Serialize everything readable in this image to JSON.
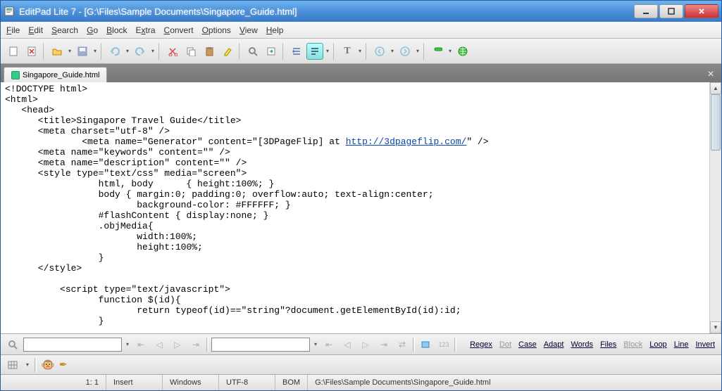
{
  "window": {
    "title": "EditPad Lite 7 - [G:\\Files\\Sample Documents\\Singapore_Guide.html]"
  },
  "menus": {
    "file": "File",
    "edit": "Edit",
    "search": "Search",
    "go": "Go",
    "block": "Block",
    "extra": "Extra",
    "convert": "Convert",
    "options": "Options",
    "view": "View",
    "help": "Help"
  },
  "tab": {
    "label": "Singapore_Guide.html"
  },
  "editor": {
    "l1": "<!DOCTYPE html>",
    "l2": "<html>",
    "l3": "   <head>",
    "l4": "      <title>Singapore Travel Guide</title>",
    "l5": "      <meta charset=\"utf-8\" />",
    "l6a": "              <meta name=\"Generator\" content=\"[3DPageFlip] at ",
    "l6link": "http://3dpageflip.com/",
    "l6b": "\" />",
    "l7": "      <meta name=\"keywords\" content=\"\" />",
    "l8": "      <meta name=\"description\" content=\"\" />",
    "l9": "      <style type=\"text/css\" media=\"screen\">",
    "l10": "                 html, body      { height:100%; }",
    "l11": "                 body { margin:0; padding:0; overflow:auto; text-align:center;",
    "l12": "                        background-color: #FFFFFF; }",
    "l13": "                 #flashContent { display:none; }",
    "l14": "                 .objMedia{",
    "l15": "                        width:100%;",
    "l16": "                        height:100%;",
    "l17": "                 }",
    "l18": "      </style>",
    "l19": "",
    "l20": "          <script type=\"text/javascript\">",
    "l21": "                 function $(id){",
    "l22": "                        return typeof(id)==\"string\"?document.getElementById(id):id;",
    "l23": "                 }"
  },
  "search_opts": {
    "regex": "Regex",
    "dot": "Dot",
    "case": "Case",
    "adapt": "Adapt",
    "words": "Words",
    "files": "Files",
    "block": "Block",
    "loop": "Loop",
    "line": "Line",
    "invert": "Invert"
  },
  "status": {
    "pos": "1: 1",
    "insert": "Insert",
    "eol": "Windows",
    "enc": "UTF-8",
    "bom": "BOM",
    "path": "G:\\Files\\Sample Documents\\Singapore_Guide.html"
  }
}
